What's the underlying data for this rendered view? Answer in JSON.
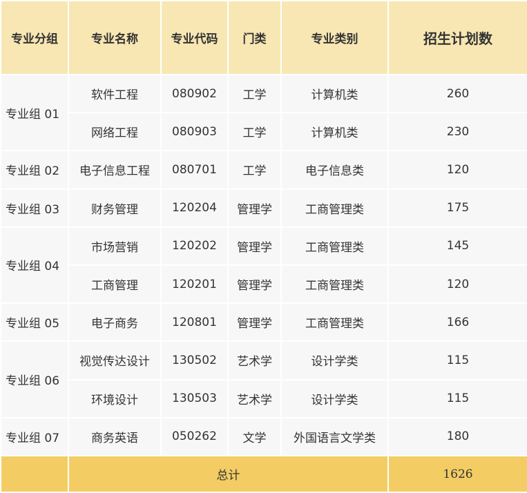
{
  "headers": [
    "专业分组",
    "专业名称",
    "专业代码",
    "门类",
    "专业类别",
    "招生计划数"
  ],
  "rows": [
    {
      "group": "专业组 01",
      "name": "软件工程",
      "code": "080902",
      "category": "工学",
      "class": "计算机类",
      "plan": "260"
    },
    {
      "group": "",
      "name": "网络工程",
      "code": "080903",
      "category": "工学",
      "class": "计算机类",
      "plan": "230"
    },
    {
      "group": "专业组 02",
      "name": "电子信息工程",
      "code": "080701",
      "category": "工学",
      "class": "电子信息类",
      "plan": "120"
    },
    {
      "group": "专业组 03",
      "name": "财务管理",
      "code": "120204",
      "category": "管理学",
      "class": "工商管理类",
      "plan": "175"
    },
    {
      "group": "专业组 04",
      "name": "市场营销",
      "code": "120202",
      "category": "管理学",
      "class": "工商管理类",
      "plan": "145"
    },
    {
      "group": "",
      "name": "工商管理",
      "code": "120201",
      "category": "管理学",
      "class": "工商管理类",
      "plan": "120"
    },
    {
      "group": "专业组 05",
      "name": "电子商务",
      "code": "120801",
      "category": "管理学",
      "class": "工商管理类",
      "plan": "166"
    },
    {
      "group": "专业组 06",
      "name": "视觉传达设计",
      "code": "130502",
      "category": "艺术学",
      "class": "设计学类",
      "plan": "115"
    },
    {
      "group": "",
      "name": "环境设计",
      "code": "130503",
      "category": "艺术学",
      "class": "设计学类",
      "plan": "115"
    },
    {
      "group": "专业组 07",
      "name": "商务英语",
      "code": "050262",
      "category": "文学",
      "class": "外国语言文学类",
      "plan": "180"
    }
  ],
  "footer": {
    "label": "总计",
    "total": "1626"
  },
  "colors": {
    "header_bg": "#f8e7b3",
    "header_border": "#f1c75a",
    "row_bg": "#f7f7f7",
    "footer_bg": "#f3cc64"
  }
}
